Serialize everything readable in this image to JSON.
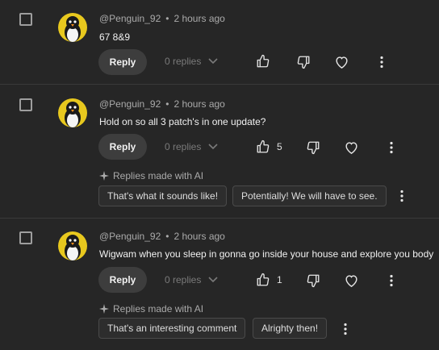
{
  "comments": [
    {
      "author": "@Penguin_92",
      "time": "2 hours ago",
      "text": "67 8&9",
      "reply_label": "Reply",
      "replies_label": "0 replies",
      "like_count": ""
    },
    {
      "author": "@Penguin_92",
      "time": "2 hours ago",
      "text": "Hold on so all 3 patch's in one update?",
      "reply_label": "Reply",
      "replies_label": "0 replies",
      "like_count": "5",
      "ai_label": "Replies made with AI",
      "suggestions": [
        "That's what it sounds like!",
        "Potentially! We will have to see."
      ]
    },
    {
      "author": "@Penguin_92",
      "time": "2 hours ago",
      "text": "Wigwam when you sleep in gonna go inside your house and explore you body",
      "reply_label": "Reply",
      "replies_label": "0 replies",
      "like_count": "1",
      "ai_label": "Replies made with AI",
      "suggestions": [
        "That's an interesting comment",
        "Alrighty then!"
      ]
    }
  ],
  "icons": {
    "checkbox": "checkbox-icon",
    "like": "thumbs-up-icon",
    "dislike": "thumbs-down-icon",
    "heart": "heart-icon",
    "more": "more-vert-icon",
    "chevron": "chevron-down-icon",
    "sparkle": "sparkle-icon"
  },
  "colors": {
    "background": "#262626",
    "avatar": "#e8c81e",
    "chip_border": "#4a4a4a"
  }
}
